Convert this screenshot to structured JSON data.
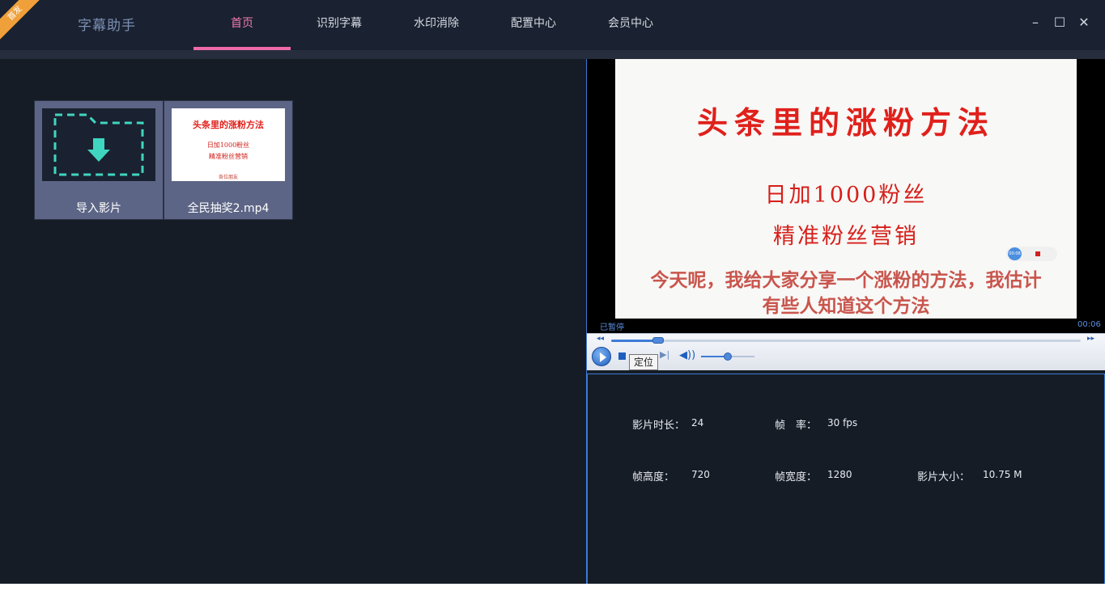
{
  "app": {
    "badge": "首发",
    "title": "字幕助手"
  },
  "nav": {
    "tabs": [
      {
        "label": "首页",
        "active": true
      },
      {
        "label": "识别字幕",
        "active": false
      },
      {
        "label": "水印消除",
        "active": false
      },
      {
        "label": "配置中心",
        "active": false
      },
      {
        "label": "会员中心",
        "active": false
      }
    ]
  },
  "window_controls": {
    "minimize": "–",
    "maximize": "☐",
    "close": "✕"
  },
  "library": {
    "import_label": "导入影片",
    "video_label": "全民抽奖2.mp4",
    "video_thumb": {
      "title": "头条里的涨粉方法",
      "line1": "日加1000粉丝",
      "line2": "精准粉丝营销",
      "sub": "各位朋友"
    }
  },
  "player": {
    "slide_title": "头条里的涨粉方法",
    "slide_line1": "日加1000粉丝",
    "slide_line2": "精准粉丝营销",
    "subtitle": "今天呢，我给大家分享一个涨粉的方法，我估计有些人知道这个方法",
    "recorder_time": "00:08",
    "status": "已暂停",
    "time": "00:06",
    "seek_progress": 0.1,
    "volume_level": 0.5,
    "tooltip": "定位"
  },
  "info": {
    "duration_label": "影片时长：",
    "duration_value": "24",
    "fps_label": "帧　率：",
    "fps_value": "30 fps",
    "height_label": "帧高度：",
    "height_value": "720",
    "width_label": "帧宽度：",
    "width_value": "1280",
    "size_label": "影片大小：",
    "size_value": "10.75 M"
  },
  "colors": {
    "accent": "#ef6aa8",
    "background": "#161c26",
    "titlebar": "#1a2130",
    "player_border": "#3a7bd5",
    "import_icon": "#3fd6c0"
  }
}
